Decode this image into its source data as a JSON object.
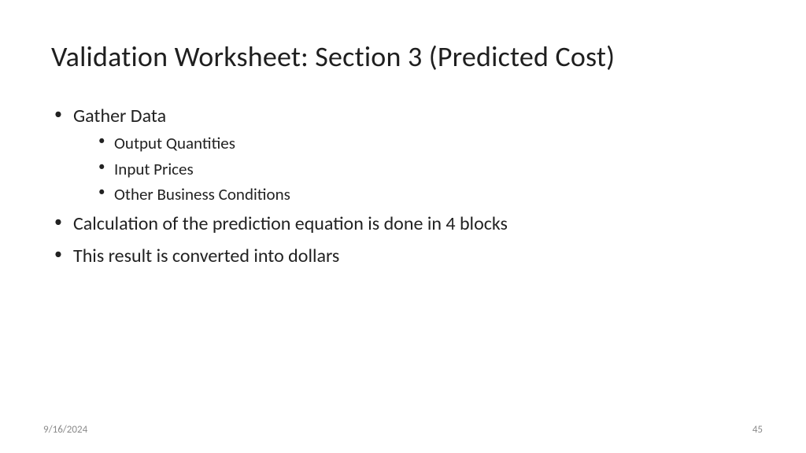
{
  "title": "Validation Worksheet: Section 3 (Predicted Cost)",
  "bullets": {
    "b1": "Gather Data",
    "b1_sub": {
      "s1": "Output Quantities",
      "s2": "Input Prices",
      "s3": "Other Business Conditions"
    },
    "b2": "Calculation of the prediction equation is done in 4 blocks",
    "b3": "This result is converted into dollars"
  },
  "footer": {
    "date": "9/16/2024",
    "page": "45"
  }
}
